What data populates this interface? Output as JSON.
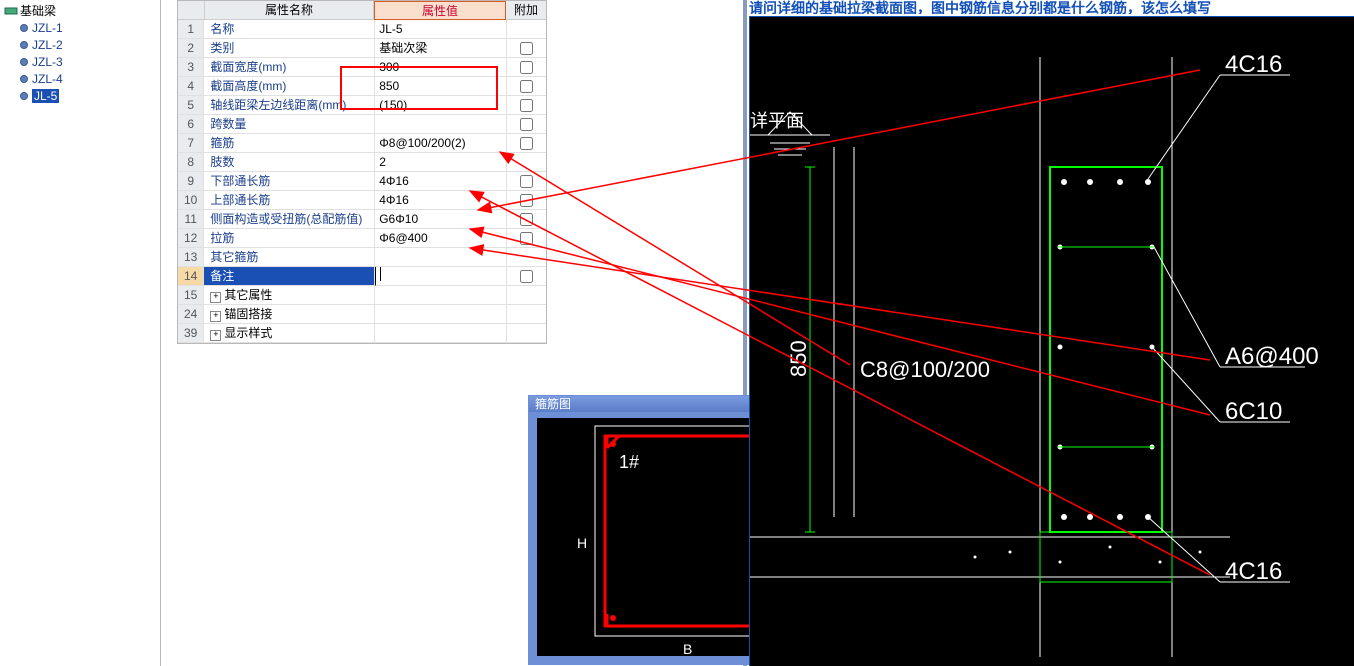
{
  "tree": {
    "root": "基础梁",
    "items": [
      "JZL-1",
      "JZL-2",
      "JZL-3",
      "JZL-4",
      "JL-5"
    ],
    "selected": 4
  },
  "grid": {
    "headers": {
      "name": "属性名称",
      "value": "属性值",
      "extra": "附加"
    },
    "rows": [
      {
        "n": "1",
        "name": "名称",
        "val": "JL-5",
        "chk": false,
        "link": true
      },
      {
        "n": "2",
        "name": "类别",
        "val": "基础次梁",
        "chk": true,
        "link": true
      },
      {
        "n": "3",
        "name": "截面宽度(mm)",
        "val": "300",
        "chk": true,
        "link": true
      },
      {
        "n": "4",
        "name": "截面高度(mm)",
        "val": "850",
        "chk": true,
        "link": true
      },
      {
        "n": "5",
        "name": "轴线距梁左边线距离(mm)",
        "val": "(150)",
        "chk": true,
        "link": true
      },
      {
        "n": "6",
        "name": "跨数量",
        "val": "",
        "chk": true,
        "link": true
      },
      {
        "n": "7",
        "name": "箍筋",
        "val": "Φ8@100/200(2)",
        "chk": true,
        "link": true
      },
      {
        "n": "8",
        "name": "肢数",
        "val": "2",
        "chk": false,
        "link": true
      },
      {
        "n": "9",
        "name": "下部通长筋",
        "val": "4Φ16",
        "chk": true,
        "link": true
      },
      {
        "n": "10",
        "name": "上部通长筋",
        "val": "4Φ16",
        "chk": true,
        "link": true
      },
      {
        "n": "11",
        "name": "侧面构造或受扭筋(总配筋值)",
        "val": "G6Φ10",
        "chk": true,
        "link": true
      },
      {
        "n": "12",
        "name": "拉筋",
        "val": "Φ6@400",
        "chk": true,
        "link": true
      },
      {
        "n": "13",
        "name": "其它箍筋",
        "val": "",
        "chk": false,
        "link": true
      },
      {
        "n": "14",
        "name": "备注",
        "val": "",
        "chk": true,
        "link": true,
        "selected": true
      },
      {
        "n": "15",
        "name": "其它属性",
        "val": "",
        "exp": true,
        "link": false
      },
      {
        "n": "24",
        "name": "锚固搭接",
        "val": "",
        "exp": true,
        "link": false
      },
      {
        "n": "39",
        "name": "显示样式",
        "val": "",
        "exp": true,
        "link": false
      }
    ]
  },
  "stirrup": {
    "title": "箍筋图",
    "mark": "1#",
    "hlabel": "H",
    "blabel": "B"
  },
  "question": "请问详细的基础拉梁截面图，图中钢筋信息分别都是什么钢筋，该怎么填写",
  "cad": {
    "labels": {
      "top": "4C16",
      "stirrup": "C8@100/200",
      "right1": "A6@400",
      "right2": "6C10",
      "bottom": "4C16",
      "height": "850",
      "plane": "详平面"
    }
  }
}
